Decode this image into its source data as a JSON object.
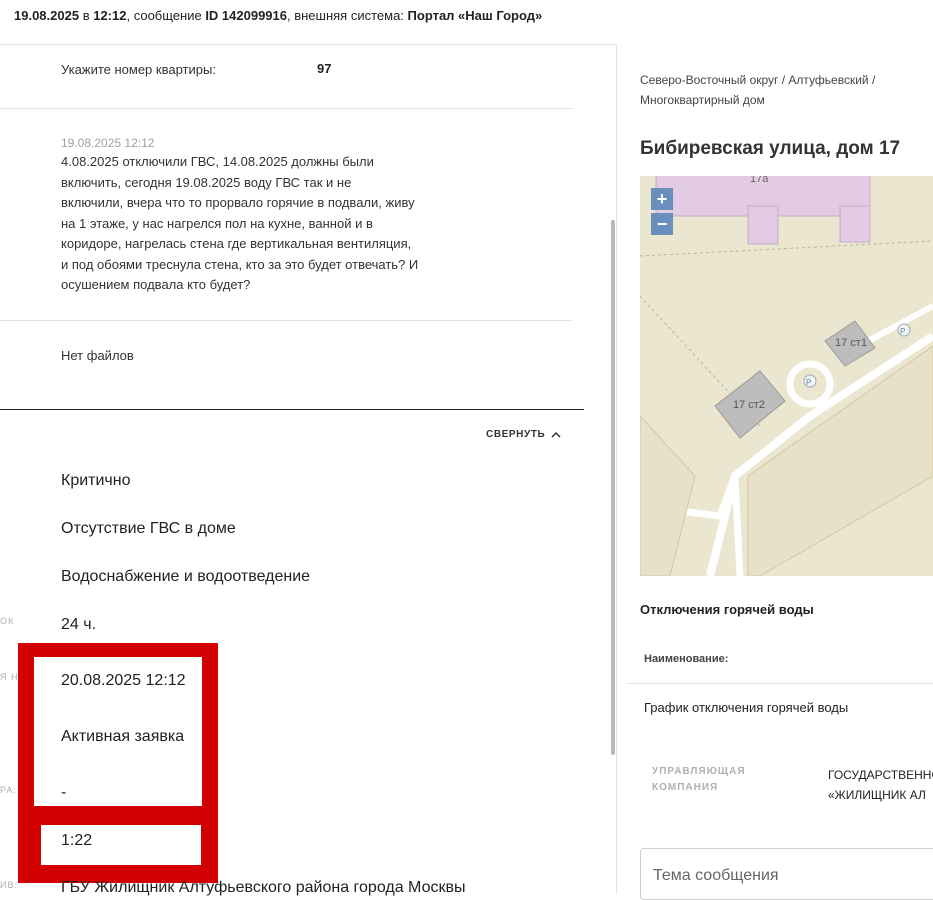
{
  "header": {
    "date": "19.08.2025",
    "sep_in": " в ",
    "time": "12:12",
    "msg_prefix": ", сообщение ",
    "msg_id": "ID 142099916",
    "system_prefix": ", внешняя система: ",
    "system_name": "Портал «Наш Город»"
  },
  "apartment": {
    "label": "Укажите номер квартиры:",
    "value": "97"
  },
  "message": {
    "timestamp": "19.08.2025 12:12",
    "lines": [
      "4.08.2025 отключили ГВС, 14.08.2025 должны были",
      "включить, сегодня 19.08.2025 воду ГВС так и не",
      "включили, вчера что то прорвало горячие в подвали, живу",
      "на 1 этаже, у нас нагрелся пол на кухне, ванной и в",
      "коридоре, нагрелась стена где вертикальная вентиляция,",
      "и под обоями треснула стена, кто за это будет отвечать? И",
      "осушением подвала кто будет?"
    ]
  },
  "files": {
    "empty_text": "Нет файлов"
  },
  "collapse": {
    "label": "СВЕРНУТЬ"
  },
  "details": {
    "priority": "Критично",
    "problem": "Отсутствие ГВС в доме",
    "category": "Водоснабжение и водоотведение",
    "deadline": "24 ч.",
    "due_date": "20.08.2025 12:12",
    "status": "Активная заявка",
    "dash": "-",
    "elapsed": "1:22",
    "organization": "ГБУ Жилищник Алтуфьевского района города Москвы"
  },
  "side_labels": {
    "l1": "ОК",
    "l2": "Я Н",
    "l3": "РА:",
    "l4": "ИВ:"
  },
  "right": {
    "breadcrumb_1": "Северо-Восточный округ / Алтуфьевский /",
    "breadcrumb_2": "Многоквартирный дом",
    "address": "Бибиревская улица, дом 17",
    "map": {
      "zoom_in": "+",
      "zoom_out": "−",
      "labels": {
        "b17a": "17а",
        "b17st1": "17 ст1",
        "b17st2": "17 ст2",
        "p1": "P",
        "p2": "P"
      }
    },
    "outage_title": "Отключения горячей воды",
    "name_header": "Наименование:",
    "schedule_link": "График отключения горячей воды",
    "mgmt_label_1": "УПРАВЛЯЮЩАЯ",
    "mgmt_label_2": "КОМПАНИЯ",
    "mgmt_value_1": "ГОСУДАРСТВЕННОЕ",
    "mgmt_value_2": "«ЖИЛИЩНИК АЛ",
    "subject_placeholder": "Тема сообщения"
  }
}
